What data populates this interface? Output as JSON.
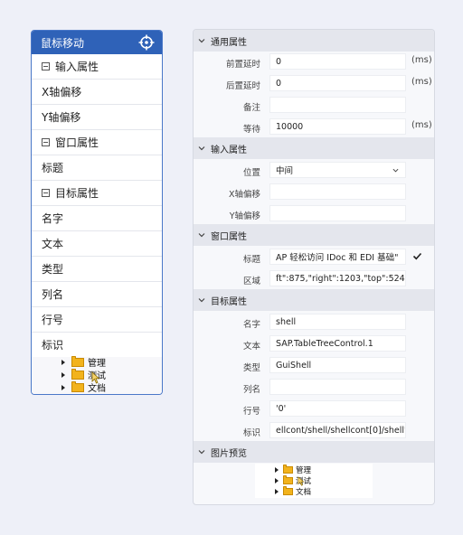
{
  "left_card": {
    "title": "鼠标移动",
    "rows": [
      {
        "label": "输入属性",
        "collapsible": true
      },
      {
        "label": "X轴偏移",
        "collapsible": false
      },
      {
        "label": "Y轴偏移",
        "collapsible": false
      },
      {
        "label": "窗口属性",
        "collapsible": true
      },
      {
        "label": "标题",
        "collapsible": false
      },
      {
        "label": "目标属性",
        "collapsible": true
      },
      {
        "label": "名字",
        "collapsible": false
      },
      {
        "label": "文本",
        "collapsible": false
      },
      {
        "label": "类型",
        "collapsible": false
      },
      {
        "label": "列名",
        "collapsible": false
      },
      {
        "label": "行号",
        "collapsible": false
      },
      {
        "label": "标识",
        "collapsible": false
      }
    ],
    "preview": [
      "管理",
      "测试",
      "文档"
    ]
  },
  "panel": {
    "general": {
      "title": "通用属性",
      "delay_before_label": "前置延时",
      "delay_before_value": "0",
      "delay_before_unit": "(ms)",
      "delay_after_label": "后置延时",
      "delay_after_value": "0",
      "delay_after_unit": "(ms)",
      "note_label": "备注",
      "note_value": "",
      "wait_label": "等待",
      "wait_value": "10000",
      "wait_unit": "(ms)"
    },
    "input": {
      "title": "输入属性",
      "position_label": "位置",
      "position_value": "中间",
      "x_offset_label": "X轴偏移",
      "x_offset_value": "",
      "y_offset_label": "Y轴偏移",
      "y_offset_value": ""
    },
    "window": {
      "title": "窗口属性",
      "caption_label": "标题",
      "caption_value": "AP 轻松访问 IDoc 和 EDI 基础\"",
      "area_label": "区域",
      "area_value": "ft\":875,\"right\":1203,\"top\":524}"
    },
    "target": {
      "title": "目标属性",
      "name_label": "名字",
      "name_value": "shell",
      "text_label": "文本",
      "text_value": "SAP.TableTreeControl.1",
      "type_label": "类型",
      "type_value": "GuiShell",
      "column_label": "列名",
      "column_value": "",
      "row_label": "行号",
      "row_value": "'0'",
      "id_label": "标识",
      "id_value": "ellcont/shell/shellcont[0]/shell'"
    },
    "preview": {
      "title": "图片预览",
      "items": [
        "管理",
        "测试",
        "文档"
      ]
    }
  },
  "colors": {
    "accent": "#2f62b8",
    "background": "#eef0f8",
    "section_header": "#e4e6ed",
    "folder": "#f2b31c"
  }
}
